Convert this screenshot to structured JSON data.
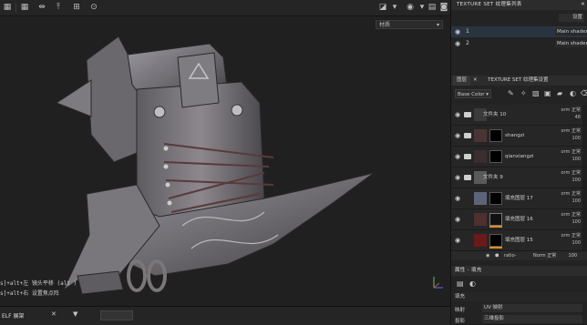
{
  "viewport": {
    "dropdown": "材质",
    "shortcuts": [
      "s]+alt+左  镜头平移 (alt )",
      "s]+alt+右  设置焦点阵"
    ]
  },
  "panel_texture_set_list": {
    "title": "TEXTURE SET 纹理集列表",
    "settings": "设置",
    "rows": [
      {
        "num": "1",
        "shader": "Main shader"
      },
      {
        "num": "2",
        "shader": "Main shader"
      }
    ]
  },
  "tabs": {
    "layers": "图层",
    "settings": "TEXTURE SET 纹理集设置"
  },
  "channel_select": "Base Color",
  "layers": [
    {
      "name": "文件夹 10",
      "blend": "orm 正常",
      "opacity": "48"
    },
    {
      "name": "shangzi",
      "blend": "orm 正常",
      "opacity": "100"
    },
    {
      "name": "qianxiangzi",
      "blend": "orm 正常",
      "opacity": "100"
    },
    {
      "name": "文件夹 9",
      "blend": "orm 正常",
      "opacity": "100"
    },
    {
      "name": "填充图层 17",
      "blend": "orm 正常",
      "opacity": "100"
    },
    {
      "name": "填充图层 16",
      "blend": "orm 正常",
      "opacity": "100"
    },
    {
      "name": "填充图层 15",
      "blend": "orm 正常",
      "opacity": "100"
    }
  ],
  "sublayer": {
    "name": "ratio-",
    "blend": "Norm 正常",
    "opacity": "100"
  },
  "properties": {
    "title": "属性 - 填充",
    "section": "填充",
    "rows": [
      {
        "label": "映射",
        "value": "UV 映射"
      },
      {
        "label": "投影",
        "value": "三维投影"
      }
    ]
  },
  "bottom": {
    "title": "ELF 展架"
  }
}
